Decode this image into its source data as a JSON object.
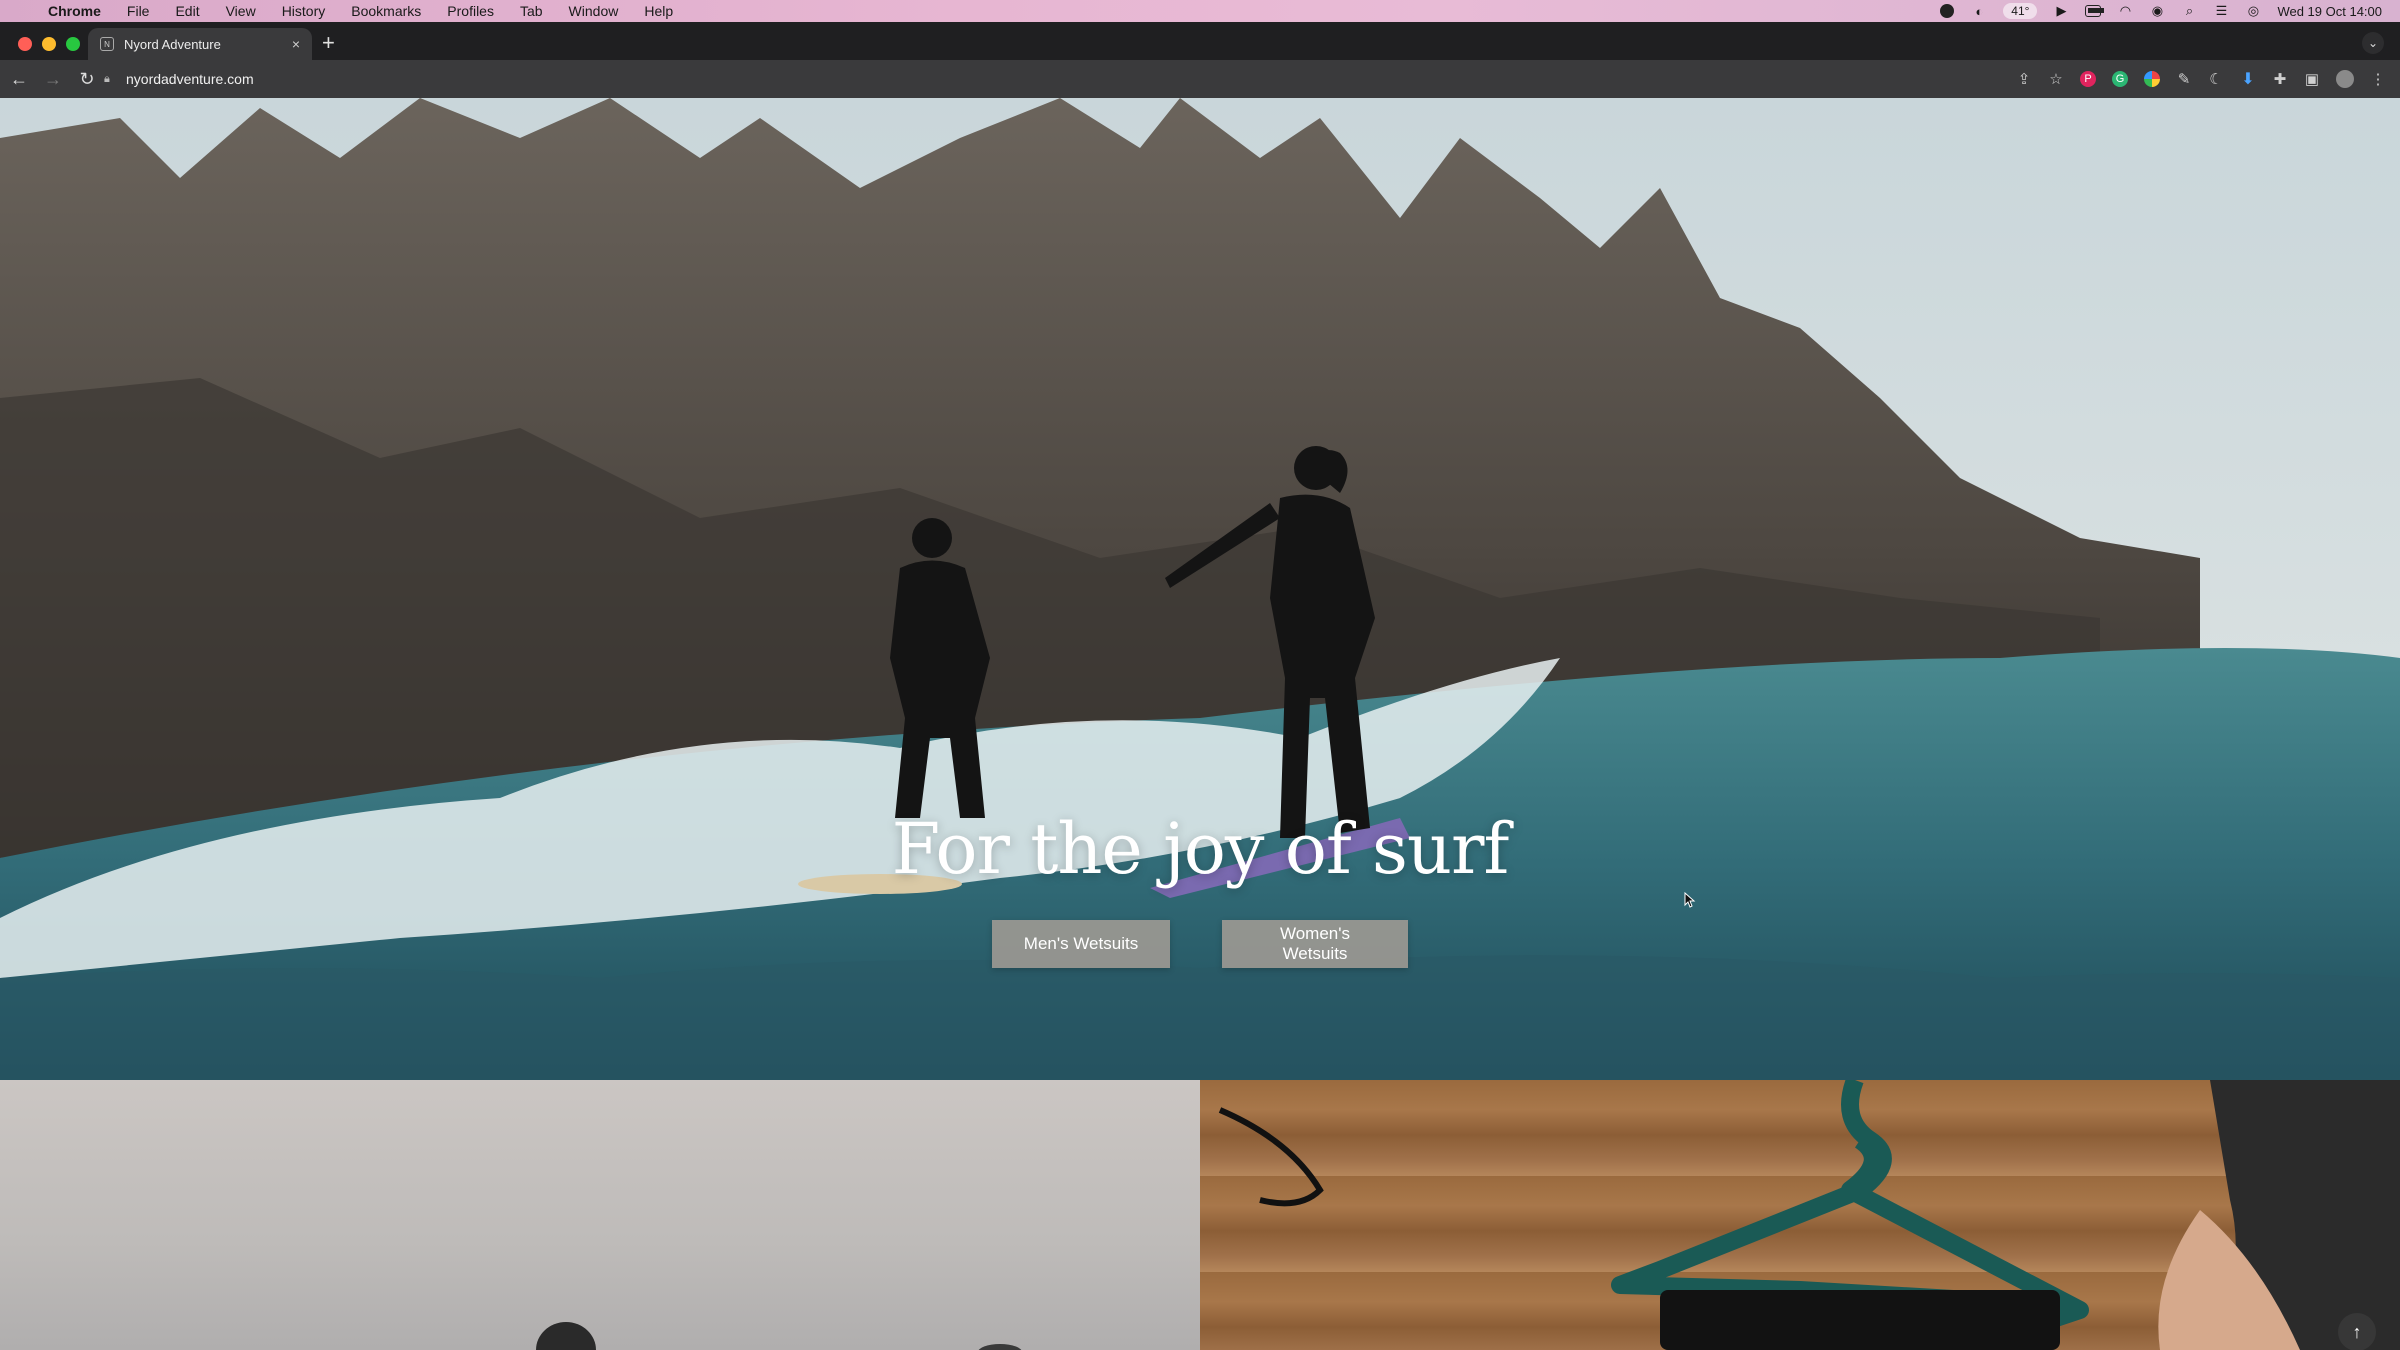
{
  "menubar": {
    "app": "Chrome",
    "items": [
      "File",
      "Edit",
      "View",
      "History",
      "Bookmarks",
      "Profiles",
      "Tab",
      "Window",
      "Help"
    ],
    "temperature": "41°",
    "datetime": "Wed 19 Oct  14:00"
  },
  "browser": {
    "tab_title": "Nyord Adventure",
    "url": "nyordadventure.com"
  },
  "hero": {
    "title": "For the joy of surf",
    "buttons": {
      "men": "Men's Wetsuits",
      "women": "Women's Wetsuits"
    }
  },
  "colors": {
    "hero_button_bg": "#a09b94",
    "hero_title": "#ffffff",
    "tab_strip": "#1f1f21",
    "toolbar": "#3a3a3c"
  }
}
